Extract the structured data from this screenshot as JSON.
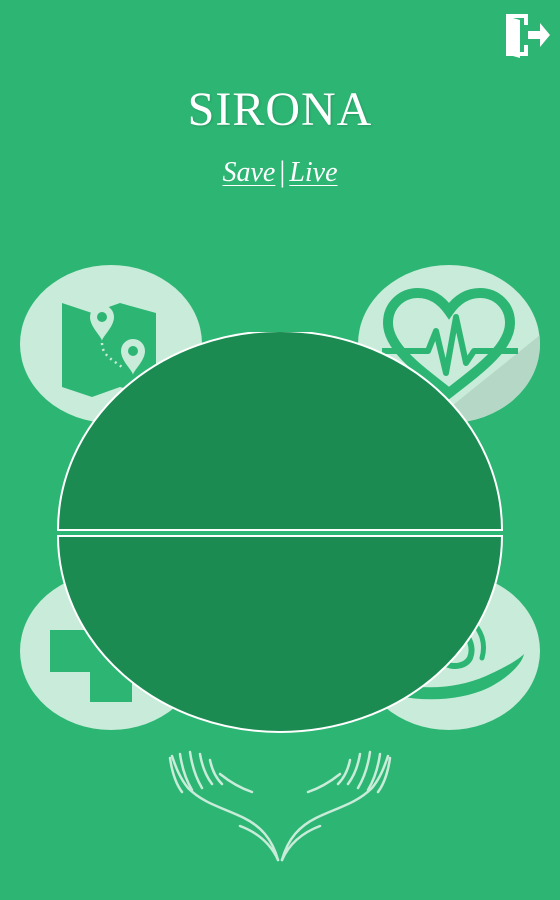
{
  "app": {
    "title": "SIRONA",
    "tagline": {
      "save": "Save",
      "separator": "|",
      "live": "Live"
    }
  },
  "header": {
    "logout_icon": "door-exit-icon"
  },
  "features": [
    {
      "name": "map-route",
      "icon": "map-route-icon"
    },
    {
      "name": "heart-rate",
      "icon": "heart-pulse-icon"
    },
    {
      "name": "first-aid",
      "icon": "medical-cross-icon"
    },
    {
      "name": "helping-hand",
      "icon": "hand-care-icon"
    }
  ],
  "dial": {
    "top_label": "",
    "bottom_label": ""
  },
  "logo": {
    "icon": "cupped-hands-icon"
  },
  "colors": {
    "background": "#2db573",
    "dial_fill": "#1b8b51",
    "circle_fill": "#c8ecd9",
    "text": "#ffffff"
  }
}
